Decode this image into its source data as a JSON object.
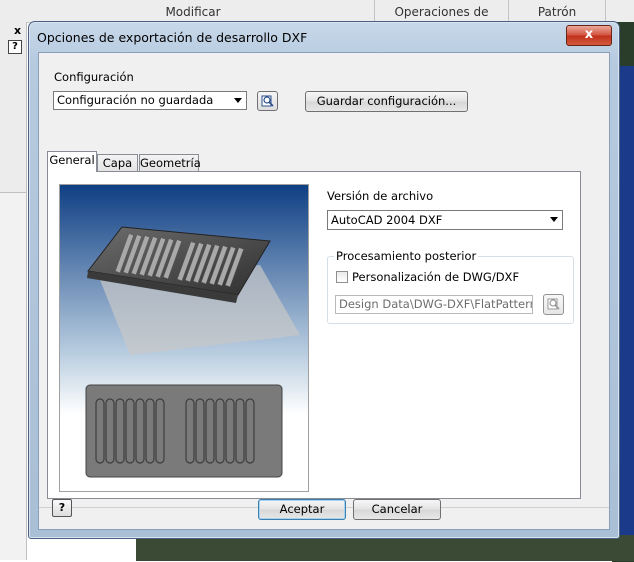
{
  "app": {
    "header_columns": [
      "Modificar",
      "Operaciones de trabajo",
      "Patrón"
    ],
    "close_glyph": "x",
    "help_glyph": "?"
  },
  "dialog": {
    "title": "Opciones de exportación de desarrollo DXF",
    "close_glyph": "x",
    "config_label": "Configuración",
    "config_value": "Configuración no guardada",
    "save_config_label": "Guardar configuración...",
    "tabs": [
      {
        "label": "General",
        "active": true
      },
      {
        "label": "Capa",
        "active": false
      },
      {
        "label": "Geometría",
        "active": false
      }
    ],
    "file_version_label": "Versión de archivo",
    "file_version_value": "AutoCAD 2004 DXF",
    "postprocess_group_title": "Procesamiento posterior",
    "customize_checkbox_label": "Personalización de DWG/DXF",
    "customize_checked": false,
    "path_value": "Design Data\\DWG-DXF\\FlatPattern.xml",
    "help_glyph": "?",
    "ok_label": "Aceptar",
    "cancel_label": "Cancelar"
  },
  "icons": [
    "browse-icon",
    "help-icon",
    "dropdown-arrow-icon",
    "close-icon",
    "preview-image"
  ],
  "colors": {
    "accent": "#3c6ab0",
    "title_bar": "#b6cadf",
    "close_button": "#c1301c"
  }
}
